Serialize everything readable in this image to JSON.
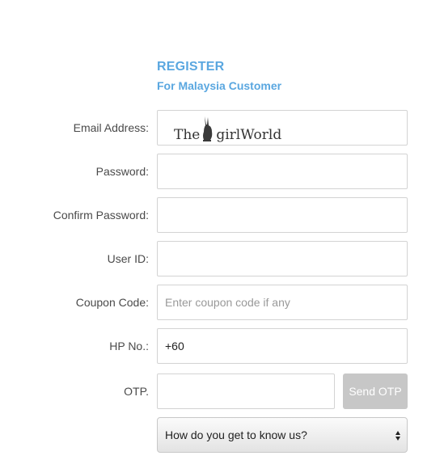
{
  "header": {
    "title": "REGISTER",
    "subtitle": "For Malaysia Customer"
  },
  "form": {
    "email": {
      "label": "Email Address:",
      "value": "",
      "placeholder": ""
    },
    "password": {
      "label": "Password:",
      "value": "",
      "placeholder": ""
    },
    "confirm_password": {
      "label": "Confirm Password:",
      "value": "",
      "placeholder": ""
    },
    "user_id": {
      "label": "User ID:",
      "value": "",
      "placeholder": ""
    },
    "coupon": {
      "label": "Coupon Code:",
      "value": "",
      "placeholder": "Enter coupon code if any"
    },
    "phone": {
      "label": "HP No.:",
      "value": "+60",
      "placeholder": ""
    },
    "otp": {
      "label": "OTP.",
      "value": "",
      "placeholder": "",
      "button_label": "Send OTP"
    },
    "referral": {
      "selected": "How do you get to know us?"
    }
  },
  "watermark": {
    "text_before": "The",
    "text_after": "girlWorld"
  },
  "colors": {
    "accent": "#5aa7e0",
    "button_disabled": "#c7c7c7"
  },
  "icons": {
    "select": "chevron-updown-icon",
    "watermark_logo": "bunny-icon"
  }
}
